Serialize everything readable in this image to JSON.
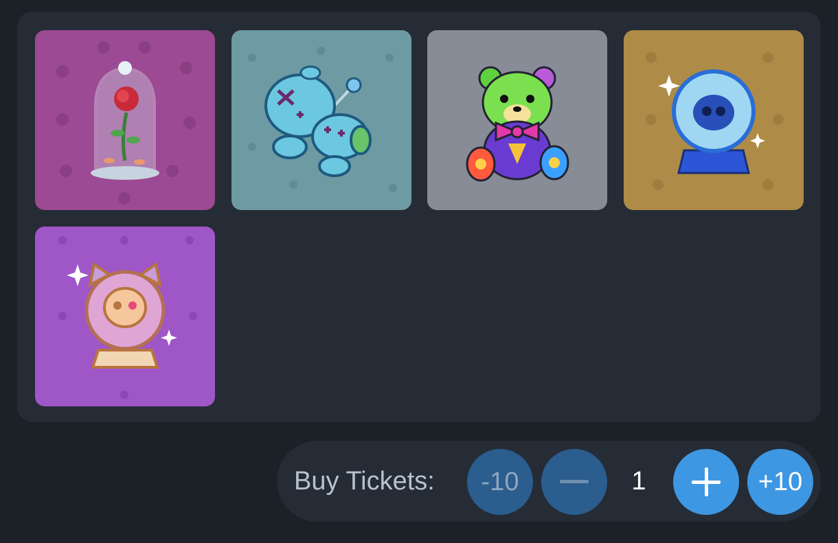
{
  "items": [
    {
      "icon": "enchanted-rose-icon",
      "bg": "#9c4a93"
    },
    {
      "icon": "voodoo-doll-icon",
      "bg": "#6d9aa3"
    },
    {
      "icon": "teddy-bear-icon",
      "bg": "#878c96"
    },
    {
      "icon": "skull-crystal-ball-icon",
      "bg": "#ae8c47"
    },
    {
      "icon": "cat-skull-snow-globe-icon",
      "bg": "#9f56c7"
    }
  ],
  "buy": {
    "label": "Buy Tickets:",
    "minus10_label": "-10",
    "quantity": "1",
    "plus10_label": "+10",
    "colors": {
      "primary": "#3e97e2",
      "dim": "#2b5d8e"
    }
  }
}
